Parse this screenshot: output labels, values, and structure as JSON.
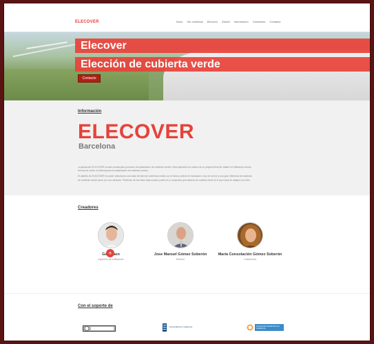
{
  "nav": {
    "brand": "ELECOVER",
    "items": [
      "Inicio",
      "Ver cubiertas",
      "Elección",
      "¡Radd!",
      "Información",
      "Creadores",
      "Contacto"
    ]
  },
  "hero": {
    "title": "Elecover",
    "subtitle": "Elección de cubierta verde",
    "button": "Contacto"
  },
  "info": {
    "heading": "Información",
    "title": "ELECOVER",
    "subtitle": "Barcelona",
    "paragraphs": [
      "La aplicación ELECOVER ha sido creada para promover la implantación de cubiertas verdes. Esta aplicación ha nacido de un proyecto final de máster en Edificación dentro",
      "la línea de nuevo un Manual para la implantación de cubiertas verdes.",
      "El objetivo de ELECOVER es poder seleccionar una clase de tales de cubiertas verdes con el mismo criterio de evaluación, muy en tal vez y una gran diferencia de sistemas",
      "de cubiertas verdes junto con sus variación. Partiendo de esa idea nada usuario podrá ver y comprobar que sistema de cubierta verde es el que mejor se adapta a su idea."
    ]
  },
  "creators": {
    "heading": "Creadores",
    "people": [
      {
        "name": "Gaiz Jaen",
        "role": "Ingeniero de edificación"
      },
      {
        "name": "Jose Manuel Gómez Soberón",
        "role": "Director"
      },
      {
        "name": "María Consolación Gómez Soberón",
        "role": "Codirectora"
      }
    ]
  },
  "support": {
    "heading": "Con el soporte de",
    "logos": [
      "cc-by-nc-nd-logo",
      "Generalitat de Catalunya",
      "Universitat Politècnica de Catalunya"
    ]
  },
  "colors": {
    "accent": "#e5423a",
    "frame": "#5a1313",
    "dark_red": "#b21e15"
  }
}
